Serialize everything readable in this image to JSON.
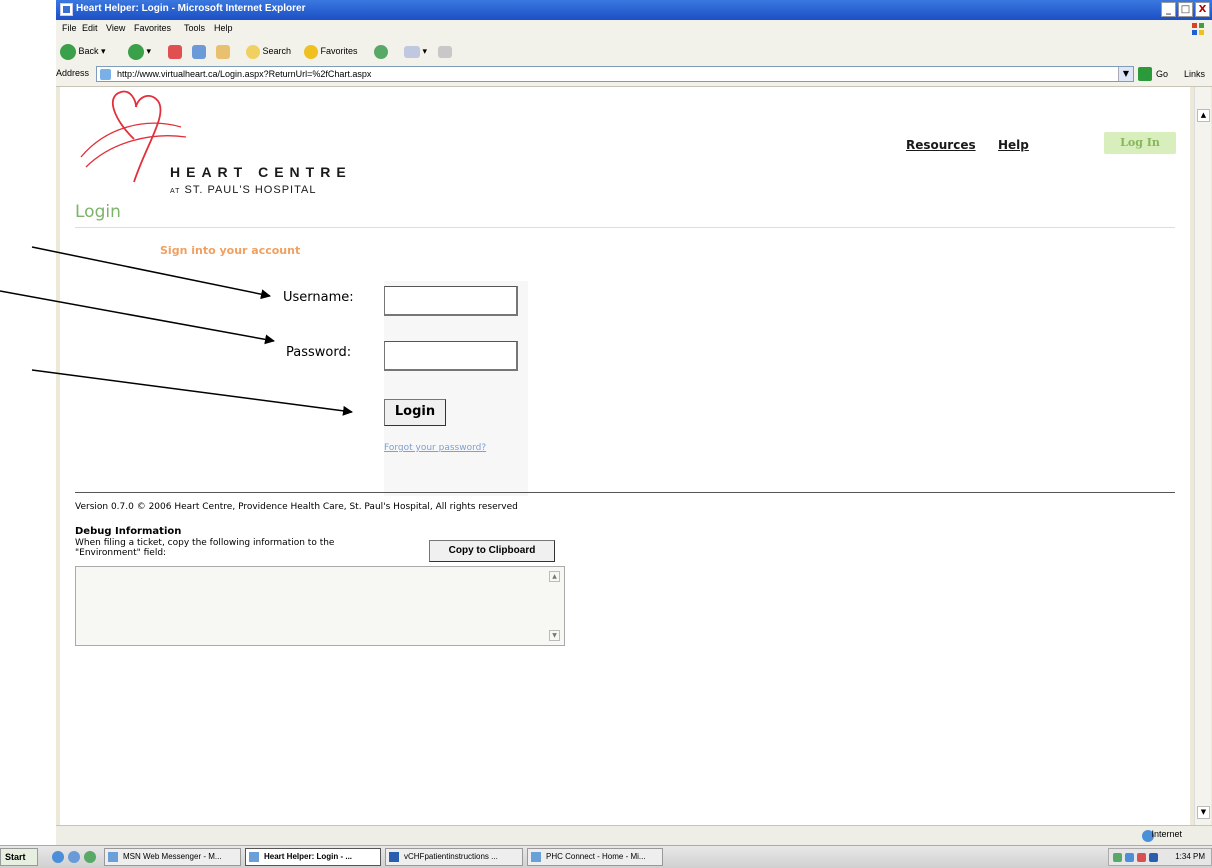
{
  "window": {
    "title": "Heart Helper: Login - Microsoft Internet Explorer",
    "controls": [
      "_",
      "□",
      "X"
    ]
  },
  "menu": [
    "File",
    "Edit",
    "View",
    "Favorites",
    "Tools",
    "Help"
  ],
  "toolbar": {
    "back": "Back",
    "search": "Search",
    "favorites": "Favorites"
  },
  "address": {
    "label": "Address",
    "url": "http://www.virtualheart.ca/Login.aspx?ReturnUrl=%2fChart.aspx",
    "go": "Go",
    "links": "Links"
  },
  "site": {
    "brand_line1": "HEART CENTRE",
    "brand_at": "AT",
    "brand_line2": "ST. PAUL'S HOSPITAL",
    "nav": {
      "resources": "Resources",
      "help": "Help",
      "login": "Log In"
    }
  },
  "page": {
    "title": "Login",
    "subtitle": "Sign into your account",
    "username_label": "Username:",
    "password_label": "Password:",
    "login_button": "Login",
    "forgot_link": "Forgot your password?"
  },
  "footer": {
    "version": "Version 0.7.0 © 2006 Heart Centre, Providence Health Care, St. Paul's Hospital, All rights reserved",
    "debug_title": "Debug Information",
    "debug_instructions": "When filing a ticket, copy the following information to the \"Environment\" field:",
    "copy_button": "Copy to Clipboard"
  },
  "status": {
    "zone": "Internet"
  },
  "taskbar": {
    "start": "Start",
    "tasks": [
      "MSN Web Messenger - M...",
      "Heart Helper: Login - ...",
      "vCHFpatientinstructions ...",
      "PHC Connect - Home - Mi..."
    ],
    "clock": "1:34 PM"
  },
  "colors": {
    "accent_green": "#7db36a",
    "login_pill_bg": "#d8eebc",
    "subtitle_orange": "#f0a060",
    "logo_red": "#e2303a",
    "link_blue": "#7fa0d4"
  }
}
